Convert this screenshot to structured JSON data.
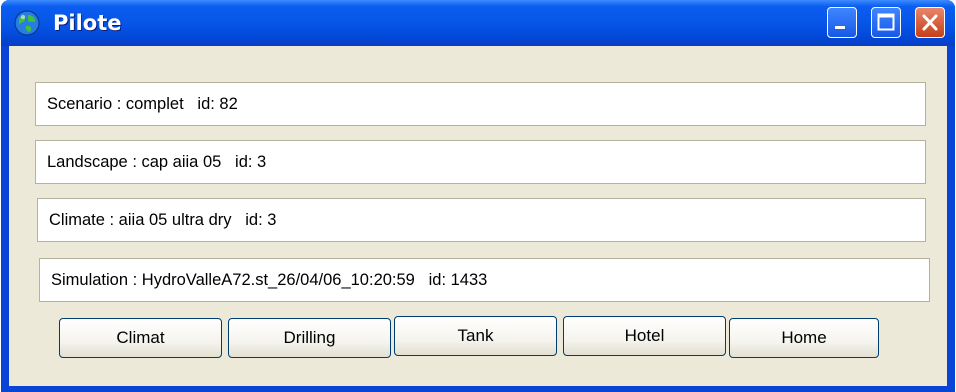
{
  "window": {
    "title": "Pilote",
    "app_icon": "globe-icon",
    "controls": {
      "minimize_icon": "minimize-icon",
      "maximize_icon": "maximize-icon",
      "close_icon": "close-icon"
    }
  },
  "info": {
    "scenario": "Scenario : complet   id: 82",
    "landscape": "Landscape : cap aiia 05   id: 3",
    "climate": "Climate : aiia 05 ultra dry   id: 3",
    "simulation": "Simulation : HydroValleA72.st_26/04/06_10:20:59   id: 1433"
  },
  "buttons": {
    "climat": "Climat",
    "drilling": "Drilling",
    "tank": "Tank",
    "hotel": "Hotel",
    "home": "Home"
  },
  "colors": {
    "titlebar": "#0654e6",
    "client_bg": "#ece9d8",
    "close_button": "#c53f18"
  }
}
